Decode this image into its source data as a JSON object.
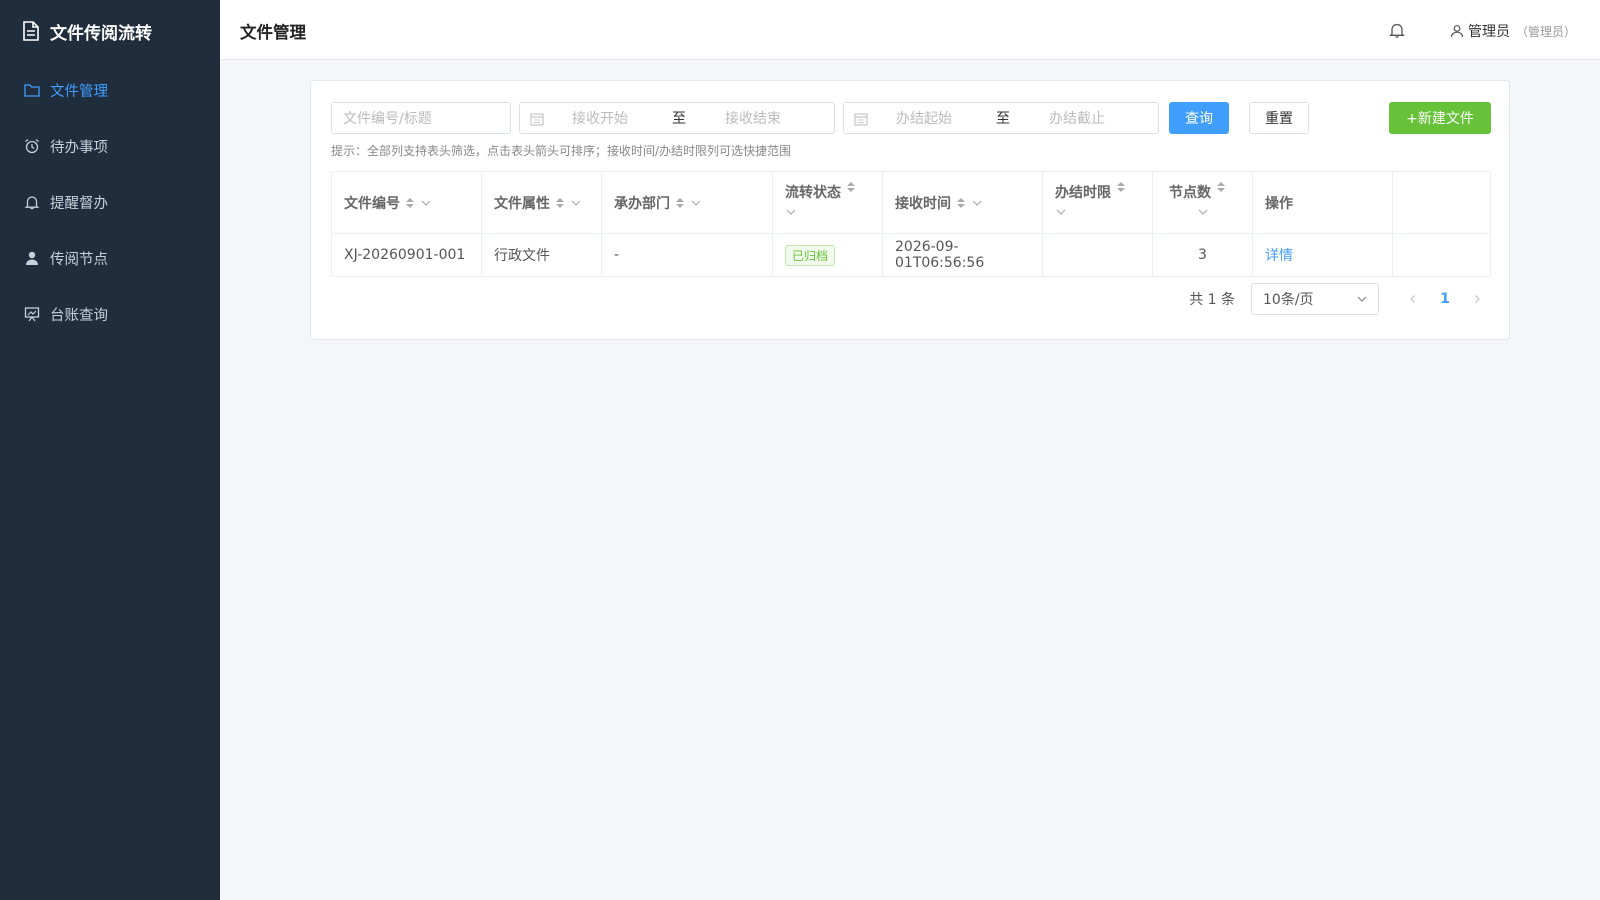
{
  "app": {
    "title": "文件传阅流转"
  },
  "sidebar": {
    "items": [
      {
        "label": "文件管理",
        "icon": "folder-icon",
        "active": true
      },
      {
        "label": "待办事项",
        "icon": "alarm-clock-icon",
        "active": false
      },
      {
        "label": "提醒督办",
        "icon": "bell-icon",
        "active": false
      },
      {
        "label": "传阅节点",
        "icon": "user-icon",
        "active": false
      },
      {
        "label": "台账查询",
        "icon": "chart-board-icon",
        "active": false
      }
    ]
  },
  "header": {
    "title": "文件管理",
    "user_name": "管理员",
    "user_role": "（管理员）"
  },
  "filters": {
    "keyword_placeholder": "文件编号/标题",
    "receive_start_placeholder": "接收开始",
    "receive_end_placeholder": "接收结束",
    "finish_start_placeholder": "办结起始",
    "finish_end_placeholder": "办结截止",
    "range_separator": "至",
    "query_label": "查询",
    "reset_label": "重置",
    "new_label": "+新建文件"
  },
  "hint": "提示：全部列支持表头筛选，点击表头箭头可排序；接收时间/办结时限列可选快捷范围",
  "table": {
    "columns": [
      "文件编号",
      "文件属性",
      "承办部门",
      "流转状态",
      "接收时间",
      "办结时限",
      "节点数",
      "操作"
    ],
    "rows": [
      {
        "file_no": "XJ-20260901-001",
        "attribute": "行政文件",
        "department": "-",
        "status": "已归档",
        "received_at": "2026-09-01T06:56:56",
        "deadline": "",
        "nodes": "3",
        "action": "详情"
      }
    ]
  },
  "pagination": {
    "total_text": "共 1 条",
    "page_size": "10条/页",
    "current_page": "1"
  },
  "colors": {
    "sidebar_bg": "#1f2d3d",
    "accent": "#409eff",
    "success": "#67c23a"
  }
}
